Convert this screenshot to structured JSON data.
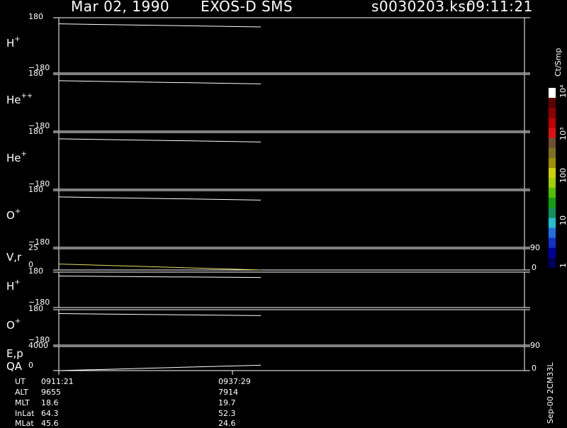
{
  "header": {
    "date": "Mar 02, 1990",
    "instrument": "EXOS-D SMS",
    "file": "s0030203.ksr",
    "time": "09:11:21"
  },
  "colorbar": {
    "units": "Ct/Smp",
    "ticks": [
      "1",
      "10",
      "100",
      "10³",
      "10⁴"
    ],
    "colors": [
      "#000060",
      "#0000a0",
      "#1030d0",
      "#2070e0",
      "#20c0d0",
      "#109060",
      "#10a010",
      "#50c000",
      "#a0d000",
      "#d0d000",
      "#a09000",
      "#807020",
      "#705030",
      "#e01010",
      "#c00000",
      "#900000",
      "#600000",
      "#ffffff"
    ]
  },
  "panels": [
    {
      "label": "H",
      "sup": "+",
      "y_top": "180",
      "y_bottom": "−180"
    },
    {
      "label": "He",
      "sup": "++",
      "y_top": "180",
      "y_bottom": "−180"
    },
    {
      "label": "He",
      "sup": "+",
      "y_top": "180",
      "y_bottom": "−180"
    },
    {
      "label": "O",
      "sup": "+",
      "y_top": "180",
      "y_bottom": "−180"
    },
    {
      "label": "V,r",
      "sup": "",
      "y_top": "25",
      "y_bottom": "0",
      "right_top": "90",
      "right_bottom": "0"
    },
    {
      "label": "H",
      "sup": "+",
      "y_top": "180",
      "y_bottom": "−180"
    },
    {
      "label": "O",
      "sup": "+",
      "y_top": "180",
      "y_bottom": "−180"
    },
    {
      "label": "E,p",
      "label2": "QA",
      "sup": "",
      "y_top": "4000",
      "y_bottom": "0",
      "right_top": "90",
      "right_bottom": "0"
    }
  ],
  "footer": {
    "rows": [
      {
        "name": "UT",
        "v1": "0911:21",
        "v2": "0937:29"
      },
      {
        "name": "ALT",
        "v1": "9655",
        "v2": "7914"
      },
      {
        "name": "MLT",
        "v1": "18.6",
        "v2": "19.7"
      },
      {
        "name": "InLat",
        "v1": "64.3",
        "v2": "52.3"
      },
      {
        "name": "MLat",
        "v1": "45.6",
        "v2": "24.6"
      }
    ],
    "stamp": "Sep-00 2CM33L"
  },
  "chart_data": {
    "type": "line",
    "title": "Mar 02, 1990   EXOS-D SMS",
    "x_range": [
      "0911:21",
      "0937:29"
    ],
    "series": [
      {
        "name": "H+",
        "y_range": [
          -180,
          180
        ],
        "values": [
          140,
          120
        ]
      },
      {
        "name": "He++",
        "y_range": [
          -180,
          180
        ],
        "values": [
          140,
          120
        ]
      },
      {
        "name": "He+",
        "y_range": [
          -180,
          180
        ],
        "values": [
          140,
          120
        ]
      },
      {
        "name": "O+",
        "y_range": [
          -180,
          180
        ],
        "values": [
          140,
          120
        ]
      },
      {
        "name": "V,r",
        "y_range": [
          0,
          25
        ],
        "values": [
          7,
          0
        ]
      },
      {
        "name": "H+",
        "y_range": [
          -180,
          180
        ],
        "values": [
          140,
          125
        ]
      },
      {
        "name": "O+",
        "y_range": [
          -180,
          180
        ],
        "values": [
          140,
          120
        ]
      },
      {
        "name": "E,p QA",
        "y_range": [
          0,
          4000
        ],
        "values": [
          0,
          900
        ]
      }
    ]
  }
}
